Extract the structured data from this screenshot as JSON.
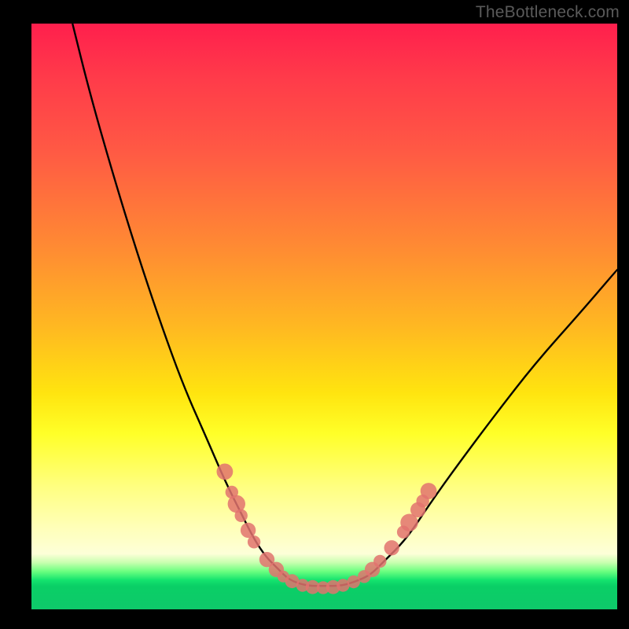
{
  "watermark": "TheBottleneck.com",
  "colors": {
    "frame": "#000000",
    "curve": "#000000",
    "dot": "#e2736e",
    "gradient_top": "#ff1f4d",
    "gradient_mid": "#ffe40f",
    "gradient_bottom": "#0ec96a"
  },
  "chart_data": {
    "type": "line",
    "title": "",
    "xlabel": "",
    "ylabel": "",
    "xlim": [
      0,
      100
    ],
    "ylim": [
      0,
      100
    ],
    "grid": false,
    "legend": false,
    "series": [
      {
        "name": "bottleneck-curve",
        "x": [
          7,
          10,
          14,
          18,
          22,
          26,
          30,
          33,
          36,
          38,
          40,
          42,
          44,
          47,
          50,
          53,
          56,
          58,
          60,
          64,
          68,
          73,
          79,
          86,
          94,
          100
        ],
        "y": [
          100,
          88,
          74,
          61,
          49,
          38,
          29,
          22,
          16,
          12,
          9,
          7,
          5,
          4,
          4,
          4,
          5,
          6,
          8,
          12,
          18,
          25,
          33,
          42,
          51,
          58
        ]
      }
    ],
    "scatter": [
      {
        "name": "left-cluster",
        "points": [
          {
            "x": 33.0,
            "y": 23.5,
            "r": 1.4
          },
          {
            "x": 34.2,
            "y": 20.0,
            "r": 1.1
          },
          {
            "x": 35.0,
            "y": 18.0,
            "r": 1.5
          },
          {
            "x": 35.8,
            "y": 16.0,
            "r": 1.1
          },
          {
            "x": 37.0,
            "y": 13.5,
            "r": 1.3
          },
          {
            "x": 38.0,
            "y": 11.5,
            "r": 1.1
          },
          {
            "x": 40.2,
            "y": 8.5,
            "r": 1.3
          },
          {
            "x": 41.8,
            "y": 6.8,
            "r": 1.3
          },
          {
            "x": 43.0,
            "y": 5.6,
            "r": 1.0
          },
          {
            "x": 44.5,
            "y": 4.8,
            "r": 1.2
          }
        ]
      },
      {
        "name": "bottom-cluster",
        "points": [
          {
            "x": 46.3,
            "y": 4.1,
            "r": 1.1
          },
          {
            "x": 48.0,
            "y": 3.8,
            "r": 1.2
          },
          {
            "x": 49.8,
            "y": 3.7,
            "r": 1.1
          },
          {
            "x": 51.5,
            "y": 3.8,
            "r": 1.2
          },
          {
            "x": 53.2,
            "y": 4.1,
            "r": 1.1
          },
          {
            "x": 55.0,
            "y": 4.7,
            "r": 1.1
          }
        ]
      },
      {
        "name": "right-cluster",
        "points": [
          {
            "x": 56.8,
            "y": 5.6,
            "r": 1.1
          },
          {
            "x": 58.2,
            "y": 6.8,
            "r": 1.3
          },
          {
            "x": 59.5,
            "y": 8.2,
            "r": 1.1
          },
          {
            "x": 61.5,
            "y": 10.5,
            "r": 1.3
          },
          {
            "x": 63.5,
            "y": 13.2,
            "r": 1.1
          },
          {
            "x": 64.5,
            "y": 14.8,
            "r": 1.5
          },
          {
            "x": 66.0,
            "y": 17.0,
            "r": 1.3
          },
          {
            "x": 66.8,
            "y": 18.5,
            "r": 1.1
          },
          {
            "x": 67.8,
            "y": 20.2,
            "r": 1.4
          }
        ]
      }
    ]
  }
}
